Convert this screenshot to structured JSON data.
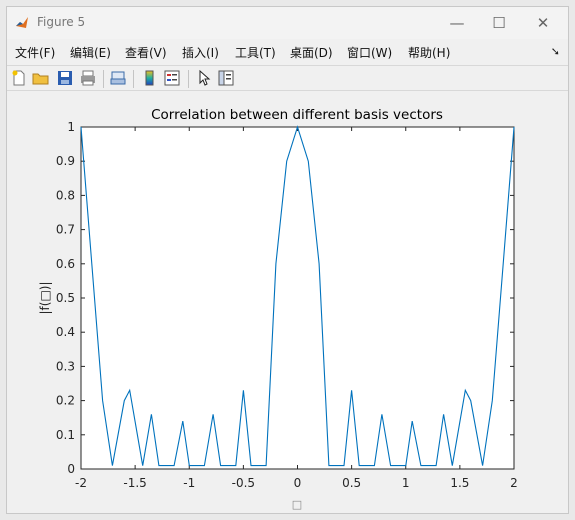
{
  "window": {
    "title": "Figure 5",
    "minimize": "—",
    "maximize": "☐",
    "close": "✕"
  },
  "menu": [
    {
      "label": "文件(F)"
    },
    {
      "label": "编辑(E)"
    },
    {
      "label": "查看(V)"
    },
    {
      "label": "插入(I)"
    },
    {
      "label": "工具(T)"
    },
    {
      "label": "桌面(D)"
    },
    {
      "label": "窗口(W)"
    },
    {
      "label": "帮助(H)"
    }
  ],
  "menu_overflow_icon": "dock-arrow-icon",
  "toolbar": [
    "new-figure-icon",
    "open-icon",
    "save-icon",
    "print-icon",
    "link-icon",
    "colorbar-icon",
    "legend-icon",
    "pointer-icon",
    "property-editor-icon"
  ],
  "chart_data": {
    "type": "line",
    "title": "Correlation between different basis vectors",
    "xlabel": "□",
    "ylabel": "|f(□)|",
    "xlim": [
      -2,
      2
    ],
    "ylim": [
      0,
      1
    ],
    "xticks": [
      "-2",
      "-1.5",
      "-1",
      "-0.5",
      "0",
      "0.5",
      "1",
      "1.5",
      "2"
    ],
    "yticks": [
      "0",
      "0.1",
      "0.2",
      "0.3",
      "0.4",
      "0.5",
      "0.6",
      "0.7",
      "0.8",
      "0.9",
      "1"
    ],
    "series": [
      {
        "color": "#0072bd",
        "x": [
          -2,
          -1.9,
          -1.8,
          -1.71,
          -1.6,
          -1.55,
          -1.43,
          -1.35,
          -1.28,
          -1.14,
          -1.06,
          -1.0,
          -0.86,
          -0.78,
          -0.71,
          -0.57,
          -0.5,
          -0.43,
          -0.29,
          -0.2,
          -0.1,
          0,
          0.1,
          0.2,
          0.29,
          0.43,
          0.5,
          0.57,
          0.71,
          0.78,
          0.86,
          1.0,
          1.06,
          1.14,
          1.28,
          1.35,
          1.43,
          1.55,
          1.6,
          1.71,
          1.8,
          1.9,
          2
        ],
        "y": [
          1,
          0.6,
          0.2,
          0.01,
          0.2,
          0.23,
          0.01,
          0.16,
          0.01,
          0.01,
          0.14,
          0.01,
          0.01,
          0.16,
          0.01,
          0.01,
          0.23,
          0.01,
          0.01,
          0.6,
          0.9,
          1,
          0.9,
          0.6,
          0.01,
          0.01,
          0.23,
          0.01,
          0.01,
          0.16,
          0.01,
          0.01,
          0.14,
          0.01,
          0.01,
          0.16,
          0.01,
          0.23,
          0.2,
          0.01,
          0.2,
          0.6,
          1
        ]
      }
    ],
    "grid": false
  }
}
